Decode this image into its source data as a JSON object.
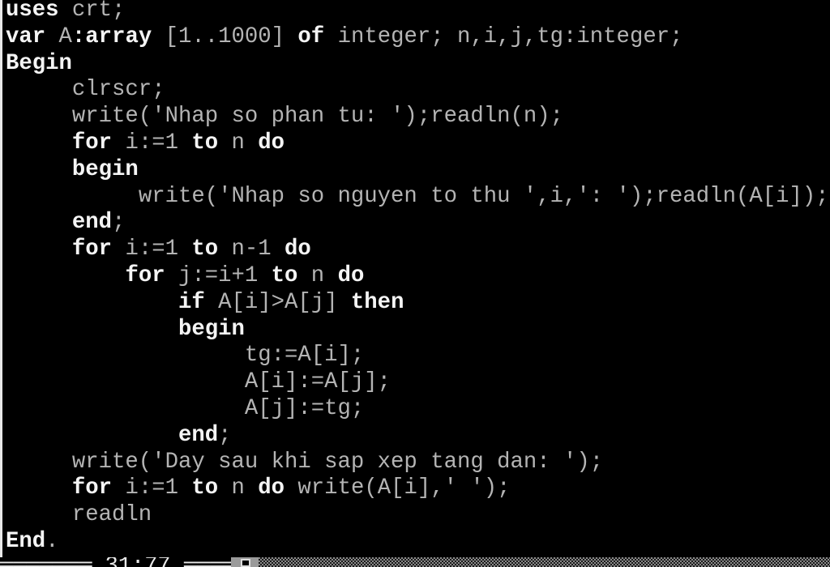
{
  "editor": {
    "lines": [
      [
        [
          "uses ",
          "kw"
        ],
        [
          "crt;",
          "id"
        ]
      ],
      [
        [
          "var ",
          "kw"
        ],
        [
          "A",
          "id"
        ],
        [
          ":array ",
          "kw"
        ],
        [
          "[1..1000] ",
          "id"
        ],
        [
          "of ",
          "kw"
        ],
        [
          "integer; n,i,j,tg:integer;",
          "id"
        ]
      ],
      [
        [
          "Begin",
          "kw"
        ]
      ],
      [
        [
          "     ",
          ""
        ],
        [
          "clrscr;",
          "id"
        ]
      ],
      [
        [
          "     ",
          ""
        ],
        [
          "write('Nhap so phan tu: ');readln(n);",
          "id"
        ]
      ],
      [
        [
          "     ",
          ""
        ],
        [
          "for ",
          "kw"
        ],
        [
          "i:=1 ",
          "id"
        ],
        [
          "to ",
          "kw"
        ],
        [
          "n ",
          "id"
        ],
        [
          "do",
          "kw"
        ]
      ],
      [
        [
          "     ",
          ""
        ],
        [
          "begin",
          "kw"
        ]
      ],
      [
        [
          "          ",
          ""
        ],
        [
          "write('Nhap so nguyen to thu ',i,': ');readln(A[i]);",
          "id"
        ]
      ],
      [
        [
          "     ",
          ""
        ],
        [
          "end",
          "kw"
        ],
        [
          ";",
          "id"
        ]
      ],
      [
        [
          "     ",
          ""
        ],
        [
          "for ",
          "kw"
        ],
        [
          "i:=1 ",
          "id"
        ],
        [
          "to ",
          "kw"
        ],
        [
          "n-1 ",
          "id"
        ],
        [
          "do",
          "kw"
        ]
      ],
      [
        [
          "         ",
          ""
        ],
        [
          "for ",
          "kw"
        ],
        [
          "j:=i+1 ",
          "id"
        ],
        [
          "to ",
          "kw"
        ],
        [
          "n ",
          "id"
        ],
        [
          "do",
          "kw"
        ]
      ],
      [
        [
          "             ",
          ""
        ],
        [
          "if ",
          "kw"
        ],
        [
          "A[i]>A[j] ",
          "id"
        ],
        [
          "then",
          "kw"
        ]
      ],
      [
        [
          "             ",
          ""
        ],
        [
          "begin",
          "kw"
        ]
      ],
      [
        [
          "                  ",
          ""
        ],
        [
          "tg:=A[i];",
          "id"
        ]
      ],
      [
        [
          "                  ",
          ""
        ],
        [
          "A[i]:=A[j];",
          "id"
        ]
      ],
      [
        [
          "                  ",
          ""
        ],
        [
          "A[j]:=tg;",
          "id"
        ]
      ],
      [
        [
          "             ",
          ""
        ],
        [
          "end",
          "kw"
        ],
        [
          ";",
          "id"
        ]
      ],
      [
        [
          "     ",
          ""
        ],
        [
          "write('Day sau khi sap xep tang dan: ');",
          "id"
        ]
      ],
      [
        [
          "     ",
          ""
        ],
        [
          "for ",
          "kw"
        ],
        [
          "i:=1 ",
          "id"
        ],
        [
          "to ",
          "kw"
        ],
        [
          "n ",
          "id"
        ],
        [
          "do ",
          "kw"
        ],
        [
          "write(A[i],' ');",
          "id"
        ]
      ],
      [
        [
          "     ",
          ""
        ],
        [
          "readln",
          "id"
        ]
      ],
      [
        [
          "End",
          "kw"
        ],
        [
          ".",
          "id"
        ]
      ]
    ]
  },
  "status": {
    "frame_text": "═══════ 31:77 ═════",
    "cursor_position": "31:77"
  },
  "colors": {
    "background": "#000000",
    "keyword": "#f4f4f4",
    "text": "#b4b4b4"
  }
}
